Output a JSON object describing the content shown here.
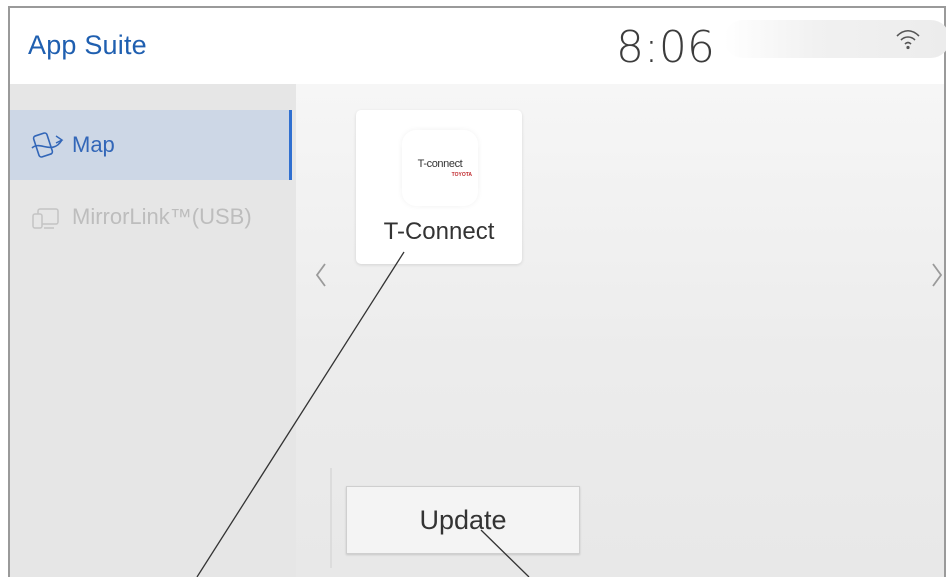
{
  "header": {
    "title": "App Suite",
    "time": "8:06",
    "wifi_icon": "wifi-icon"
  },
  "sidebar": {
    "items": [
      {
        "label": "Map",
        "icon": "phone-map-icon",
        "state": "active"
      },
      {
        "label": "MirrorLink™(USB)",
        "icon": "mirrorlink-icon",
        "state": "disabled"
      }
    ]
  },
  "apps": [
    {
      "label": "T-Connect",
      "logo_text": "T-connect",
      "logo_sub": "TOYOTA"
    }
  ],
  "nav": {
    "prev_icon": "chevron-left-icon",
    "next_icon": "chevron-right-icon"
  },
  "actions": {
    "update_label": "Update"
  },
  "colors": {
    "accent": "#2f6fd0",
    "title": "#1f5fb0",
    "sidebar_bg": "#e6e6e6",
    "active_item_bg": "#cdd7e6",
    "toyota_red": "#c0282d"
  }
}
